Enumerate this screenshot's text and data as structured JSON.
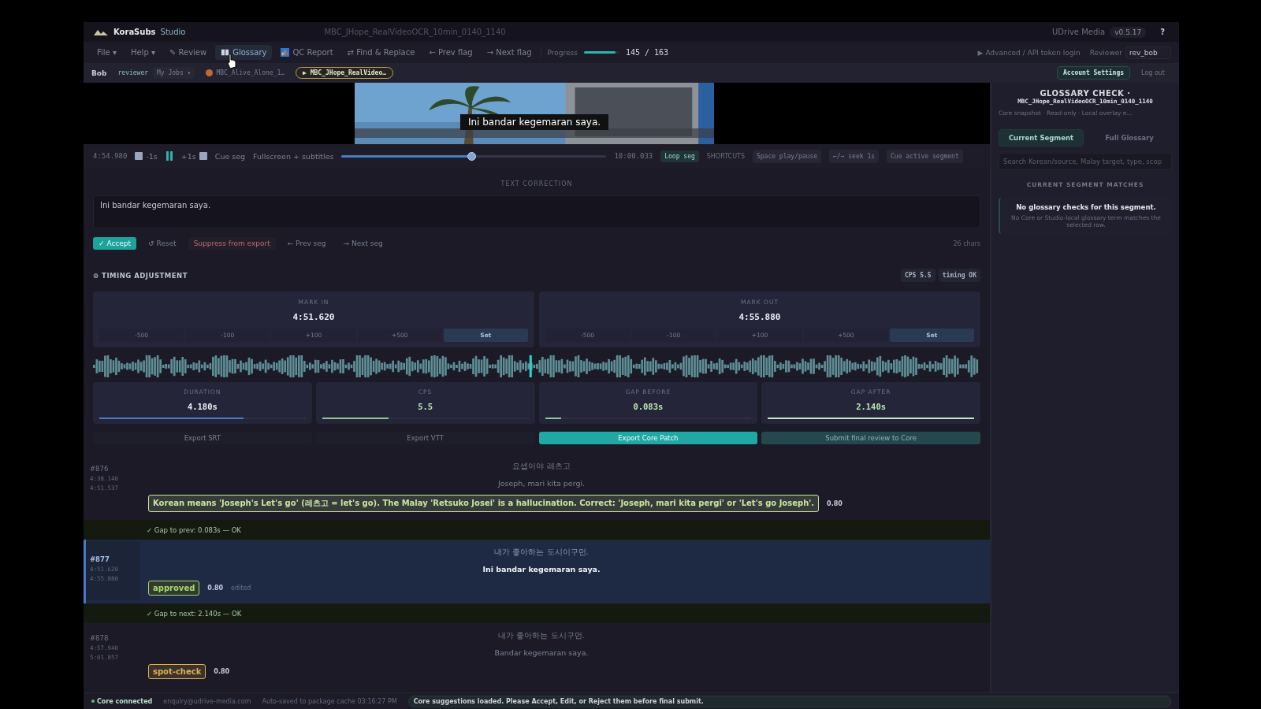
{
  "app": {
    "name": "KoraSubs",
    "suffix": "Studio",
    "file_title": "MBC_JHope_RealVideoOCR_10min_0140_1140",
    "org": "UDrive Media",
    "version": "v0.5.17",
    "help": "?"
  },
  "menu": [
    {
      "label": "File ▾",
      "kind": "plain",
      "selected": false
    },
    {
      "label": "Help ▾",
      "kind": "plain",
      "selected": false
    },
    {
      "label": "✎ Review",
      "kind": "plain",
      "selected": false
    },
    {
      "label": "Glossary",
      "kind": "book",
      "selected": true
    },
    {
      "label": "QC Report",
      "kind": "chart",
      "selected": false
    },
    {
      "label": "⇄ Find & Replace",
      "kind": "plain",
      "selected": false
    },
    {
      "label": "← Prev flag",
      "kind": "plain",
      "selected": false
    },
    {
      "label": "→ Next flag",
      "kind": "plain",
      "selected": false
    }
  ],
  "progress": {
    "label": "Progress",
    "level": 0.89,
    "count": "145 / 163"
  },
  "login": {
    "advanced": "▶ Advanced / API token login",
    "reviewer_label": "Reviewer",
    "reviewer_value": "rev_bob"
  },
  "userbar": {
    "user": "Bob",
    "role": "reviewer",
    "jobs": "My Jobs ▾",
    "account": "Account Settings",
    "logout": "Log out"
  },
  "job_tabs": [
    {
      "label": "MBC_Alive_Alone_1…",
      "selected": false
    },
    {
      "label": "▶ MBC_JHope_RealVideo…",
      "selected": true
    }
  ],
  "video": {
    "subtitle": "Ini bandar kegemaran saya."
  },
  "player": {
    "current": "4:54.980",
    "back": "-1s",
    "forward": "+1s",
    "cue": "Cue seg",
    "fullscreen": "Fullscreen + subtitles",
    "level": 0.49,
    "duration": "10:00.033",
    "loop": "Loop seg",
    "shortcuts_label": "SHORTCUTS",
    "shortcuts": [
      "Space play/pause",
      "←/→ seek 1s",
      "Cue active segment"
    ]
  },
  "correction": {
    "label": "TEXT CORRECTION",
    "value": "Ini bandar kegemaran saya.",
    "chars": "26 chars",
    "actions": [
      {
        "label": "✓ Accept",
        "kind": "primary"
      },
      {
        "label": "↺ Reset",
        "kind": "ghost"
      },
      {
        "label": "Suppress from export",
        "kind": "danger"
      },
      {
        "label": "← Prev seg",
        "kind": "ghost"
      },
      {
        "label": "→ Next seg",
        "kind": "ghost"
      }
    ]
  },
  "timing": {
    "title": "⊙ TIMING ADJUSTMENT",
    "badges": [
      "CPS 5.5",
      "timing OK"
    ],
    "marks": [
      {
        "label": "MARK IN",
        "time": "4:51.620",
        "nudges": [
          "-500",
          "-100",
          "+100",
          "+500"
        ],
        "set": "Set"
      },
      {
        "label": "MARK OUT",
        "time": "4:55.880",
        "nudges": [
          "-500",
          "-100",
          "+100",
          "+500"
        ],
        "set": "Set"
      }
    ],
    "stats": [
      {
        "label": "DURATION",
        "value": "4.180s",
        "level": 0.7,
        "color": "#4a7cc0"
      },
      {
        "label": "CPS",
        "value": "5.5",
        "level": 0.32,
        "color": "#8fc98f"
      },
      {
        "label": "GAP BEFORE",
        "value": "0.083s",
        "level": 0.08,
        "color": "#8fc98f"
      },
      {
        "label": "GAP AFTER",
        "value": "2.140s",
        "level": 1,
        "color": "#c9e6c2"
      }
    ]
  },
  "exports": [
    {
      "label": "Export SRT",
      "kind": "plain"
    },
    {
      "label": "Export VTT",
      "kind": "plain"
    },
    {
      "label": "Export Core Patch",
      "kind": "primary"
    },
    {
      "label": "Submit final review to Core",
      "kind": "disabled"
    }
  ],
  "segments": [
    {
      "kind": "segment",
      "number": "#876",
      "start": "4:38.140",
      "end": "4:51.537",
      "source": "요셉이야 레츠고",
      "target": "Joseph, mari kita pergi.",
      "selected": false,
      "tag": {
        "text": "Korean means 'Joseph's Let's go' (레츠고 = let's go). The Malay 'Retsuko Josei' is a hallucination. Correct: 'Joseph, mari kita pergi' or 'Let's go Joseph'.",
        "color": "#c8e6a0"
      },
      "score": "0.80"
    },
    {
      "kind": "gap",
      "text": "✓ Gap to prev: 0.083s — OK"
    },
    {
      "kind": "segment",
      "number": "#877",
      "start": "4:51.620",
      "end": "4:55.880",
      "source": "내가 좋아하는 도시이구먼.",
      "target": "Ini bandar kegemaran saya.",
      "selected": true,
      "tag": {
        "text": "approved",
        "color": "#a6d96a"
      },
      "score": "0.80",
      "flag": "edited"
    },
    {
      "kind": "gap",
      "text": "✓ Gap to next: 2.140s — OK"
    },
    {
      "kind": "segment",
      "number": "#878",
      "start": "4:57.940",
      "end": "5:01.857",
      "source": "내가 좋아하는 도시구먼.",
      "target": "Bandar kegemaran saya.",
      "selected": false,
      "tag": {
        "text": "spot-check",
        "color": "#e0b050"
      },
      "score": "0.80"
    }
  ],
  "glossary": {
    "title": "GLOSSARY CHECK ·",
    "file": "MBC_JHope_RealVideoOCR_10min_0140_1140",
    "meta": "Core snapshot · Read-only · Local overlay e…",
    "tabs": [
      {
        "label": "Current Segment",
        "selected": true
      },
      {
        "label": "Full Glossary",
        "selected": false
      }
    ],
    "search_placeholder": "Search Korean/source, Malay target, type, scop",
    "section": "CURRENT SEGMENT MATCHES",
    "empty_title": "No glossary checks for this segment.",
    "empty_body": "No Core or Studio-local glossary term matches the selected row."
  },
  "status_bar": {
    "connection": "Core connected",
    "email": "enquiry@udrive-media.com",
    "autosave": "Auto-saved to package cache 03:16:27 PM",
    "message": "Core suggestions loaded. Please Accept, Edit, or Reject them before final submit."
  }
}
